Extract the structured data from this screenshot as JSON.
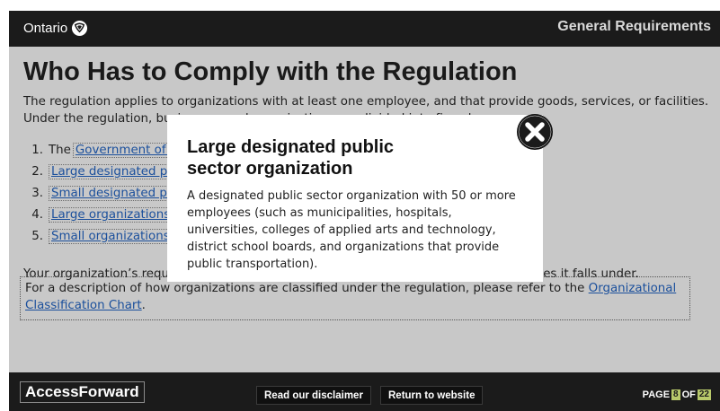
{
  "header": {
    "brand": "Ontario",
    "section_title": "General Requirements"
  },
  "main": {
    "title": "Who Has to Comply with the Regulation",
    "intro_line_1": "The regulation applies to organizations with at least one employee, and that provide goods, services, or facilities.",
    "intro_line_2": "Under the regulation, businesses and organizations are divided into five classes:",
    "classes": [
      {
        "number": "1.",
        "prefix": "The",
        "label": "Government of Ontario and the Legislative Assembly"
      },
      {
        "number": "2.",
        "prefix": "",
        "label": "Large designated public sector organizations"
      },
      {
        "number": "3.",
        "prefix": "",
        "label": "Small designated public sector organizations"
      },
      {
        "number": "4.",
        "prefix": "",
        "label": "Large organizations"
      },
      {
        "number": "5.",
        "prefix": "",
        "label": "Small organizations"
      }
    ],
    "requirements_text": "Your organization’s requirements under the regulation depend on which of these classes it falls under.",
    "description_line_1_text": "For a description of how organizations are classified under the regulation, please refer to the",
    "description_link_part_1": "Organizational",
    "description_link_part_2": "Classification Chart",
    "description_end": "."
  },
  "modal": {
    "title_line_1": "Large designated public",
    "title_line_2": "sector organization",
    "body_lines": [
      "A designated public sector organization with 50 or more",
      "employees (such as municipalities, hospitals,",
      "universities, colleges of applied arts and technology,",
      "district school boards, and organizations that provide",
      "public transportation)."
    ],
    "close_icon": "close-x-circle-icon"
  },
  "footer": {
    "logo": "AccessForward",
    "disclaimer_button": "Read our disclaimer",
    "return_button": "Return to website",
    "page_label": "PAGE",
    "page_current": "8",
    "page_of": "OF",
    "page_total": "22"
  },
  "colors": {
    "bar_background": "#1b1b1b",
    "page_background": "#c8c8c8",
    "link": "#1a4f9c",
    "page_indicator": "#b8c96a"
  }
}
